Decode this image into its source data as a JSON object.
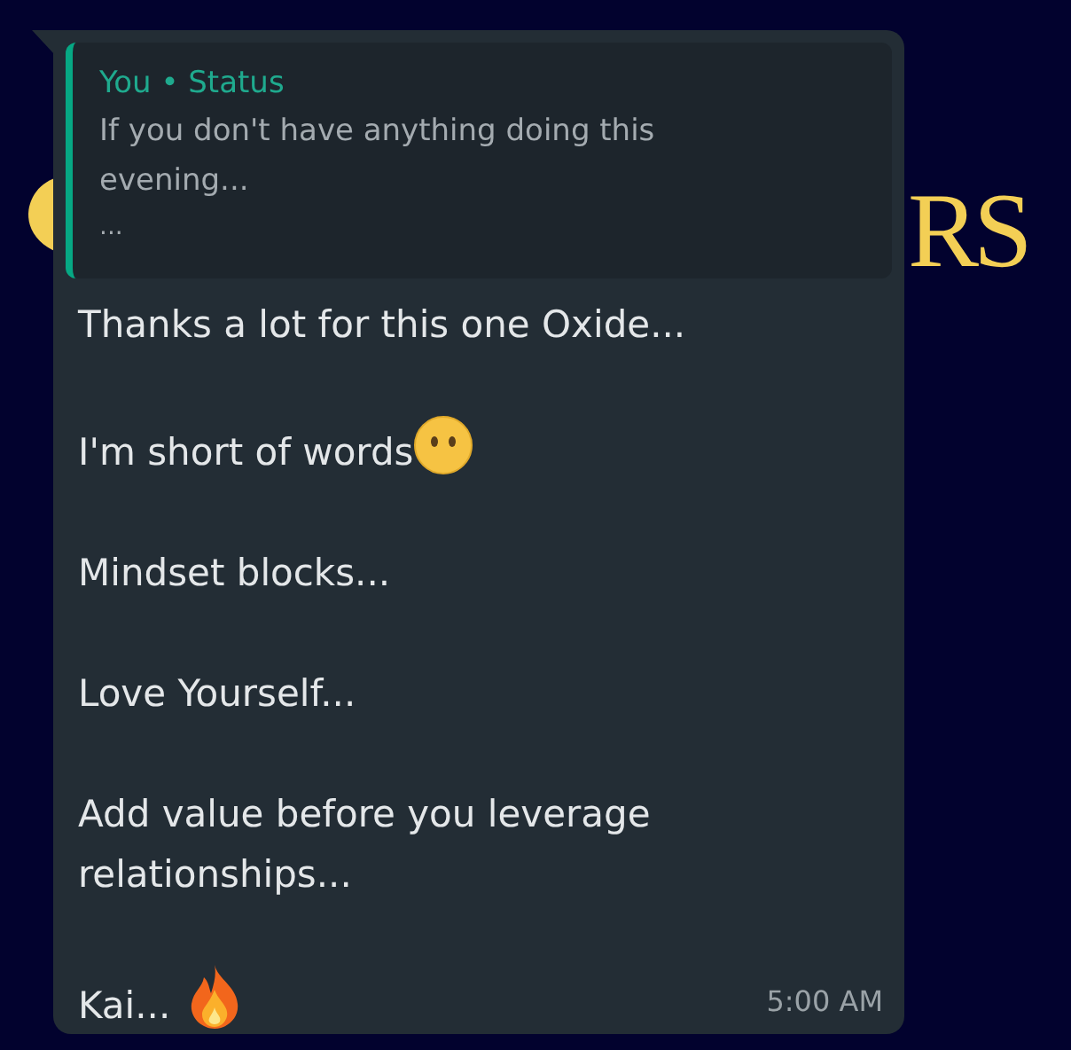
{
  "background": {
    "logo_text": "RS"
  },
  "message": {
    "quote": {
      "header": "You • Status",
      "text": "If you don't have anything doing this evening...",
      "more": "..."
    },
    "paragraphs": [
      {
        "text": "Thanks a lot for this one Oxide..."
      },
      {
        "text": "I'm short of words",
        "emoji": {
          "kind": "face"
        }
      },
      {
        "text": "Mindset blocks..."
      },
      {
        "text": "Love Yourself..."
      },
      {
        "text": "Add value before you leverage relationships..."
      },
      {
        "text": "Kai...",
        "emoji": {
          "kind": "fire"
        }
      }
    ],
    "time": "5:00 AM"
  }
}
